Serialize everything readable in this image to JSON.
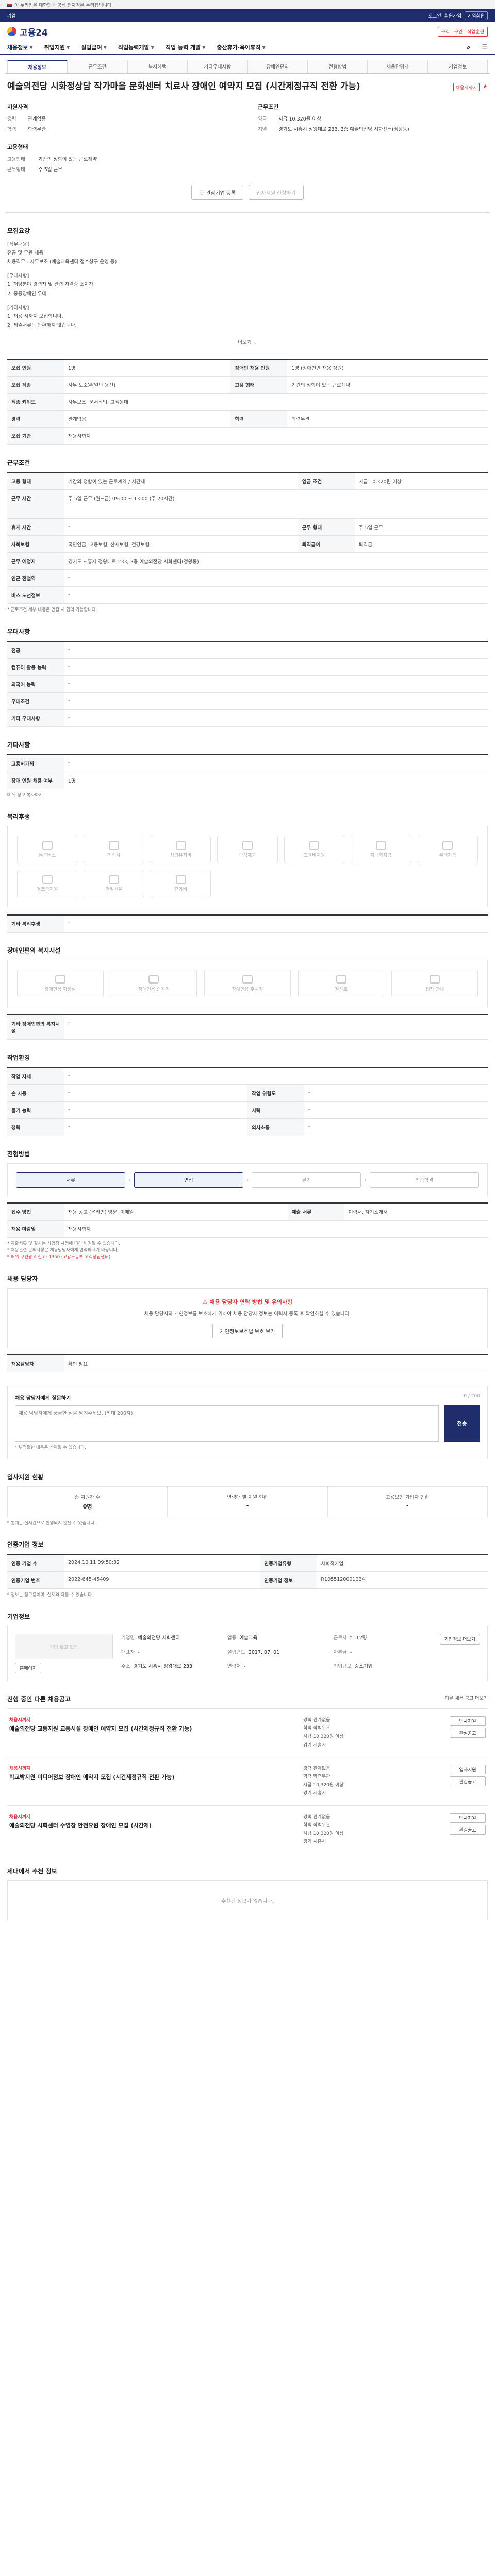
{
  "banner": {
    "left": "이 누리집은 대한민국 공식 전자정부 누리집입니다.",
    "right": ""
  },
  "topbar": {
    "left": "기업",
    "mid": "",
    "links": [
      "로그인",
      "회원가입",
      "기업회원"
    ]
  },
  "header": {
    "logo": "고용24",
    "right_badge": "구직 · 구인 · 직업훈련"
  },
  "gnb": [
    "채용정보",
    "취업지원",
    "실업급여",
    "직업능력개발",
    "직업 능력 개발",
    "출산휴가·육아휴직"
  ],
  "tabs": [
    "채용정보",
    "근무조건",
    "복지혜택",
    "기타우대사항",
    "장애인편의",
    "전형방법",
    "채용담당자",
    "기업정보"
  ],
  "title": {
    "badge": "채용시까지",
    "text": "예술의전당 시화정상담 작가마을 문화센터 치료사 장애인 예약지 모집 (시간제정규직 전환 가능)"
  },
  "summary": {
    "left_title": "지원자격",
    "left": [
      {
        "k": "경력",
        "v": "관계없음"
      },
      {
        "k": "학력",
        "v": "학력무관"
      }
    ],
    "right_title": "근무조건",
    "right": [
      {
        "k": "임금",
        "v": "시급 10,320원 이상"
      },
      {
        "k": "지역",
        "v": "경기도 시흥시 정왕대로 233, 3층 예술의전당 시화센터(정왕동)"
      }
    ]
  },
  "summary2": {
    "title": "고용형태",
    "rows": [
      {
        "k": "고용형태",
        "v": "기간의 정함이 있는 근로계약"
      },
      {
        "k": "근무형태",
        "v": "주 5일 근무"
      }
    ]
  },
  "actions": {
    "apply": "관심기업 등록",
    "scrap": "입사지원 신청하기"
  },
  "job_desc": {
    "title": "모집요강",
    "lines": [
      "[직무내용]",
      "전공 및 무관 채용",
      "채용직무 : 사무보조 (예술교육센터 접수창구 운영 등)",
      "",
      "[우대사항]",
      "1. 해당분야 경력자 및 관련 자격증 소지자",
      "2. 중증장애인 우대",
      "",
      "[기타사항]",
      "1. 채용 시까지 모집합니다.",
      "2. 제출서류는 반환하지 않습니다."
    ],
    "more": "더보기"
  },
  "cond_table": [
    {
      "k": "모집 인원",
      "v": "1명",
      "k2": "장애인 채용 인원",
      "v2": "1명 (장애인만 채용 정원)"
    },
    {
      "k": "모집 직종",
      "v": "사무 보조원(일반 용산)",
      "k2": "고용 형태",
      "v2": "기간의 정함이 있는 근로계약"
    },
    {
      "k": "직종 키워드",
      "v": "사무보조, 문서작업, 고객응대"
    },
    {
      "k": "경력",
      "v": "관계없음",
      "k2": "학력",
      "v2": "학력무관"
    },
    {
      "k": "모집 기간",
      "v": "채용시까지"
    }
  ],
  "work_table": {
    "title": "근무조건",
    "rows": [
      {
        "k": "고용 형태",
        "v": "기간의 정함이 있는 근로계약 / 시간제",
        "k2": "임금 조건",
        "v2": "시급 10,320원 이상"
      },
      {
        "k": "근무 시간",
        "v": "주 5일 근무 (월~금) 09:00 ~ 13:00 (주 20시간)",
        "k2": "",
        "v2": ""
      },
      {
        "k": "휴게 시간",
        "v": "-",
        "k2": "근무 형태",
        "v2": "주 5일 근무"
      },
      {
        "k": "사회보험",
        "v": "국민연금, 고용보험, 산재보험, 건강보험",
        "k2": "퇴직급여",
        "v2": "퇴직금"
      },
      {
        "k": "근무 예정지",
        "v": "경기도 시흥시 정왕대로 233, 3층 예술의전당 시화센터(정왕동)",
        "k2": "",
        "v2": ""
      },
      {
        "k": "인근 전철역",
        "v": "-",
        "k2": "",
        "v2": ""
      },
      {
        "k": "버스 노선정보",
        "v": "-",
        "k2": "",
        "v2": ""
      }
    ],
    "note": "* 근로조건 세부 내용은 면접 시 협의 가능합니다."
  },
  "pref_table": {
    "title": "우대사항",
    "rows": [
      {
        "k": "전공",
        "v": "-"
      },
      {
        "k": "컴퓨터 활용 능력",
        "v": "-"
      },
      {
        "k": "외국어 능력",
        "v": "-"
      },
      {
        "k": "우대조건",
        "v": "-"
      },
      {
        "k": "기타 우대사항",
        "v": "-"
      }
    ]
  },
  "etc_table": {
    "title": "기타사항",
    "rows": [
      {
        "k": "고용허가제",
        "v": "-"
      },
      {
        "k": "장애 인원 채용 여부",
        "v": "1명"
      }
    ],
    "link": "위 정보 복사하기"
  },
  "benefits": {
    "title": "복리후생",
    "items": [
      "통근버스",
      "기숙사",
      "차량유지비",
      "중식제공",
      "교육비지원",
      "자녀학자금",
      "주택자금",
      "경조금지원",
      "명절선물",
      "휴가비"
    ],
    "extra_k": "기타 복리후생",
    "extra_v": "-"
  },
  "disability": {
    "title": "장애인편의 복지시설",
    "items": [
      "장애인용 화장실",
      "장애인용 승강기",
      "장애인용 주차장",
      "경사로",
      "점자 안내"
    ],
    "extra_k": "기타 장애인편의 복지시설",
    "extra_v": "-"
  },
  "env_table": {
    "title": "작업환경",
    "rows": [
      {
        "k": "작업 자세",
        "v": "-",
        "k2": "",
        "v2": ""
      },
      {
        "k": "손 사용",
        "v": "-",
        "k2": "작업 위험도",
        "v2": "-"
      },
      {
        "k": "들기 능력",
        "v": "-",
        "k2": "시력",
        "v2": "-"
      },
      {
        "k": "청력",
        "v": "-",
        "k2": "의사소통",
        "v2": "-"
      }
    ]
  },
  "screening": {
    "title": "전형방법",
    "steps": [
      "서류",
      "면접",
      "필기",
      "최종합격"
    ],
    "rows": [
      {
        "k": "접수 방법",
        "v": "채용 공고 (온라인) 방문, 이메일",
        "k2": "제출 서류",
        "v2": "이력서, 자기소개서"
      },
      {
        "k": "채용 마감일",
        "v": "채용시까지",
        "k2": "",
        "v2": ""
      }
    ],
    "notes": [
      "* 제출서류 및 절차는 사업장 사정에 따라 변경될 수 있습니다.",
      "* 채용관련 문의사항은 채용담당자에게 연락하시기 바랍니다.",
      "* 허위 구인광고 신고: 1350 (고용노동부 고객상담센터)"
    ]
  },
  "contact": {
    "title": "채용 담당자",
    "warn_title": "채용 담당자 연락 방법 및 유의사항",
    "warn_body": "채용 담당자와 개인정보를 보호하기 위하여 채용 담당자 정보는 이력서 등록 후 확인하실 수 있습니다.",
    "warn_btn": "개인정보보호법 보호 보기",
    "name_k": "채용담당자",
    "name_v": "확인 필요"
  },
  "feedback": {
    "title": "채용 담당자에게 질문하기",
    "placeholder": "채용 담당자에게 궁금한 점을 남겨주세요. (최대 200자)",
    "count": "0 / 200",
    "send": "전송",
    "notes": [
      "* 부적절한 내용은 삭제될 수 있습니다."
    ]
  },
  "stats": {
    "title": "입사지원 현황",
    "cells": [
      {
        "lbl": "총 지원자 수",
        "num": "0명"
      },
      {
        "lbl": "연령대 별 지원 현황",
        "num": "-"
      },
      {
        "lbl": "고용보험 가입자 현황",
        "num": "-"
      }
    ],
    "note": "* 통계는 실시간으로 반영되지 않을 수 있습니다."
  },
  "info_table": {
    "title": "인증기업 정보",
    "rows": [
      {
        "k": "인증 기업 수",
        "v": "2024.10.11 09:50:32",
        "k2": "인증기업유형",
        "v2": "사회적기업"
      },
      {
        "k": "인증기업 번호",
        "v": "2022-645-45409",
        "k2": "인증기업 정보",
        "v2": "R1055120001024"
      }
    ],
    "notes": [
      "* 정보는 참고용이며, 실제와 다를 수 있습니다."
    ]
  },
  "company": {
    "title": "기업정보",
    "logo_alt": "기업 로고 없음",
    "links": [
      "홈페이지",
      "기업정보 더보기"
    ],
    "fields": [
      {
        "lab": "기업명",
        "val": "예술의전당 시화센터"
      },
      {
        "lab": "업종",
        "val": "예술교육"
      },
      {
        "lab": "근로자 수",
        "val": "12명"
      },
      {
        "lab": "대표자",
        "val": "-"
      },
      {
        "lab": "설립년도",
        "val": "2017. 07. 01"
      },
      {
        "lab": "자본금",
        "val": "-"
      },
      {
        "lab": "주소",
        "val": "경기도 시흥시 정왕대로 233"
      },
      {
        "lab": "연락처",
        "val": "-"
      },
      {
        "lab": "기업규모",
        "val": "중소기업"
      }
    ]
  },
  "related": {
    "title": "진행 중인 다른 채용공고",
    "more": "다른 채용 공고 더보기",
    "jobs": [
      {
        "tag": "채용시까지",
        "title": "예술의전당 교통지원 교통시설 장애인 예약지 모집 (시간제정규직 전환 가능)",
        "meta": [
          "경력 관계없음",
          "학력 학력무관",
          "시급 10,320원 이상",
          "경기 시흥시"
        ]
      },
      {
        "tag": "채용시까지",
        "title": "학교밖지원 미디어정보 장애인 예약지 모집 (시간제정규직 전환 가능)",
        "meta": [
          "경력 관계없음",
          "학력 학력무관",
          "시급 10,320원 이상",
          "경기 시흥시"
        ]
      },
      {
        "tag": "채용시까지",
        "title": "예술의전당 시화센터 수영장 안전요원 장애인 모집 (시간제)",
        "meta": [
          "경력 관계없음",
          "학력 학력무관",
          "시급 10,320원 이상",
          "경기 시흥시"
        ]
      }
    ],
    "job_btns": [
      "입사지원",
      "관심공고"
    ]
  },
  "recommended": {
    "title": "제대에서 추천 정보",
    "empty": "추천된 정보가 없습니다."
  }
}
